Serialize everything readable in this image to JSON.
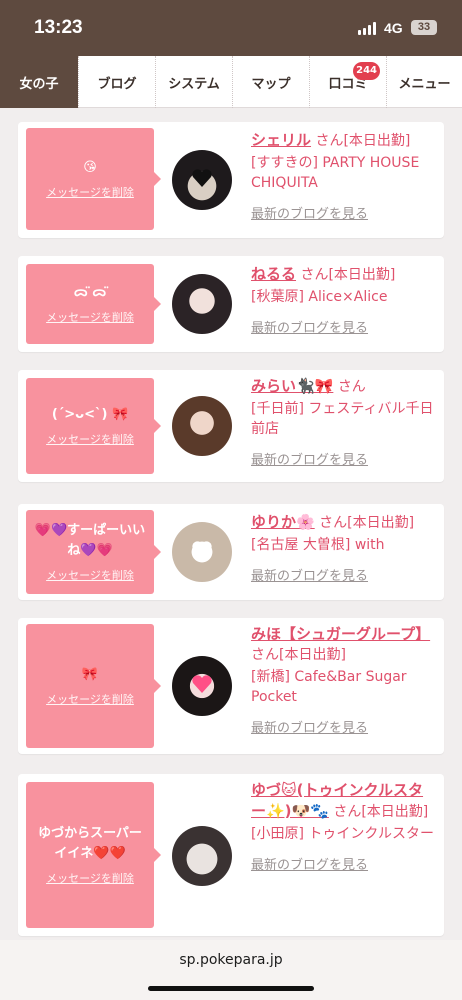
{
  "status": {
    "time": "13:23",
    "network": "4G",
    "battery": "33"
  },
  "tabs": [
    {
      "label": "女の子",
      "active": true
    },
    {
      "label": "ブログ"
    },
    {
      "label": "システム"
    },
    {
      "label": "マップ"
    },
    {
      "label": "口コミ",
      "badge": "244"
    },
    {
      "label": "メニュー"
    }
  ],
  "cards": [
    {
      "message": "😘",
      "delete_label": "メッセージを削除",
      "name": "シェリル",
      "suffix": "さん[本日出勤]",
      "shop": "[すすきの] PARTY HOUSE CHIQUITA",
      "blog_label": "最新のブログを見る"
    },
    {
      "message": "ᯅ̈ ᯅ̈",
      "delete_label": "メッセージを削除",
      "name": "ねるる",
      "suffix": "さん[本日出勤]",
      "shop": "[秋葉原] Alice×Alice",
      "blog_label": "最新のブログを見る"
    },
    {
      "message": "(ˊ>ᴗ<ˋ) 🎀",
      "delete_label": "メッセージを削除",
      "name": "みらい🐈‍⬛🎀",
      "suffix": "さん",
      "shop": "[千日前] フェスティバル千日前店",
      "blog_label": "最新のブログを見る"
    },
    {
      "message": "💗💜すーぱーいいね💜💗",
      "delete_label": "メッセージを削除",
      "name": "ゆりか🌸",
      "suffix": "さん[本日出勤]",
      "shop": "[名古屋 大曽根] with",
      "blog_label": "最新のブログを見る"
    },
    {
      "message": "🎀",
      "delete_label": "メッセージを削除",
      "name": "みほ【シュガーグループ】",
      "suffix": "さん[本日出勤]",
      "shop": "[新橋] Cafe&Bar Sugar Pocket",
      "blog_label": "最新のブログを見る"
    },
    {
      "message": "ゆづからスーパーイイネ❤️❤️",
      "delete_label": "メッセージを削除",
      "name": "ゆづ🐱(トゥインクルスター✨)🐶🐾",
      "suffix": "さん[本日出勤]",
      "shop": "[小田原] トゥインクルスター",
      "blog_label": "最新のブログを見る"
    }
  ],
  "browser": {
    "url": "sp.pokepara.jp"
  },
  "colors": {
    "brand_brown": "#5e4a3f",
    "bubble_pink": "#f8929e",
    "name_pink": "#e0516c",
    "badge_red": "#e23f4f"
  }
}
